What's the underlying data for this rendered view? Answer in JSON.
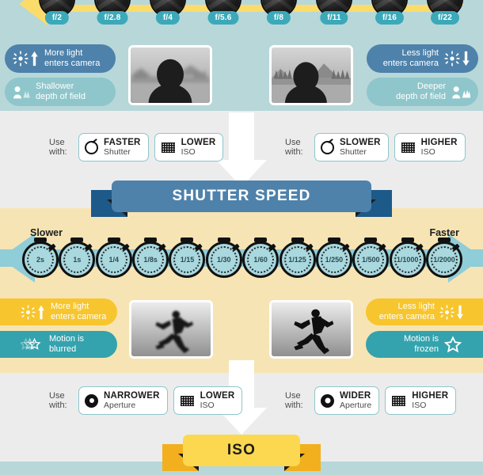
{
  "meta": {
    "doc_title": "Exposure Triangle Infographic",
    "bg_color": "#ececed"
  },
  "aperture_section": {
    "band_color": "#b7d7d9",
    "scale_color": "#fbdc6b",
    "fstops": [
      "f/2",
      "f/2.8",
      "f/4",
      "f/5.6",
      "f/8",
      "f/11",
      "f/16",
      "f/22"
    ],
    "left_pills": [
      {
        "text": "More light\nenters camera",
        "line1": "More light",
        "line2": "enters camera",
        "color": "#4e82ab",
        "icon": "sun-up-icon"
      },
      {
        "text": "Shallower\ndepth of field",
        "line1": "Shallower",
        "line2": "depth of field",
        "color": "#8ec6cb",
        "icon": "portrait-shallow-dof-icon"
      }
    ],
    "right_pills": [
      {
        "line1": "Less light",
        "line2": "enters camera",
        "color": "#4e82ab",
        "icon": "sun-down-icon"
      },
      {
        "line1": "Deeper",
        "line2": "depth of field",
        "color": "#8ec6cb",
        "icon": "portrait-deep-dof-icon"
      }
    ],
    "left_photo_caption": "portrait with blurred background",
    "right_photo_caption": "portrait with sharp background",
    "use_with_left": {
      "label_line1": "Use",
      "label_line2": "with:",
      "chips": [
        {
          "strong": "FASTER",
          "sub": "Shutter",
          "icon": "shutter-icon"
        },
        {
          "strong": "LOWER",
          "sub": "ISO",
          "icon": "iso-grid-icon"
        }
      ]
    },
    "use_with_right": {
      "label_line1": "Use",
      "label_line2": "with:",
      "chips": [
        {
          "strong": "SLOWER",
          "sub": "Shutter",
          "icon": "shutter-icon"
        },
        {
          "strong": "HIGHER",
          "sub": "ISO",
          "icon": "iso-grid-icon"
        }
      ]
    }
  },
  "shutter_section": {
    "banner_title": "SHUTTER SPEED",
    "banner_color": "#4e82ab",
    "banner_tail_color": "#1d5a8a",
    "band_color": "#f7e4b4",
    "scale_color": "#8fcdd8",
    "label_left": "Slower",
    "label_right": "Faster",
    "speeds": [
      "2s",
      "1s",
      "1/4",
      "1/8s",
      "1/15",
      "1/30",
      "1/60",
      "1/125",
      "1/250",
      "1/500",
      "1/1000",
      "1/2000"
    ],
    "left_pills": [
      {
        "line1": "More light",
        "line2": "enters camera",
        "color": "#f7c52d",
        "icon": "sun-up-icon"
      },
      {
        "line1": "Motion is",
        "line2": "blurred",
        "color": "#34a3ad",
        "icon": "blurred-stars-icon"
      }
    ],
    "right_pills": [
      {
        "line1": "Less light",
        "line2": "enters camera",
        "color": "#f7c52d",
        "icon": "sun-down-icon"
      },
      {
        "line1": "Motion is",
        "line2": "frozen",
        "color": "#34a3ad",
        "icon": "star-outline-icon"
      }
    ],
    "left_photo_caption": "blurred running figure",
    "right_photo_caption": "sharp running figure",
    "use_with_left": {
      "label_line1": "Use",
      "label_line2": "with:",
      "chips": [
        {
          "strong": "NARROWER",
          "sub": "Aperture",
          "icon": "aperture-icon"
        },
        {
          "strong": "LOWER",
          "sub": "ISO",
          "icon": "iso-grid-icon"
        }
      ]
    },
    "use_with_right": {
      "label_line1": "Use",
      "label_line2": "with:",
      "chips": [
        {
          "strong": "WIDER",
          "sub": "Aperture",
          "icon": "aperture-icon"
        },
        {
          "strong": "HIGHER",
          "sub": "ISO",
          "icon": "iso-grid-icon"
        }
      ]
    }
  },
  "iso_section": {
    "banner_title": "ISO",
    "banner_color": "#fbd84f",
    "banner_tail_color": "#f2b01e",
    "band_color": "#b7d7d9"
  }
}
